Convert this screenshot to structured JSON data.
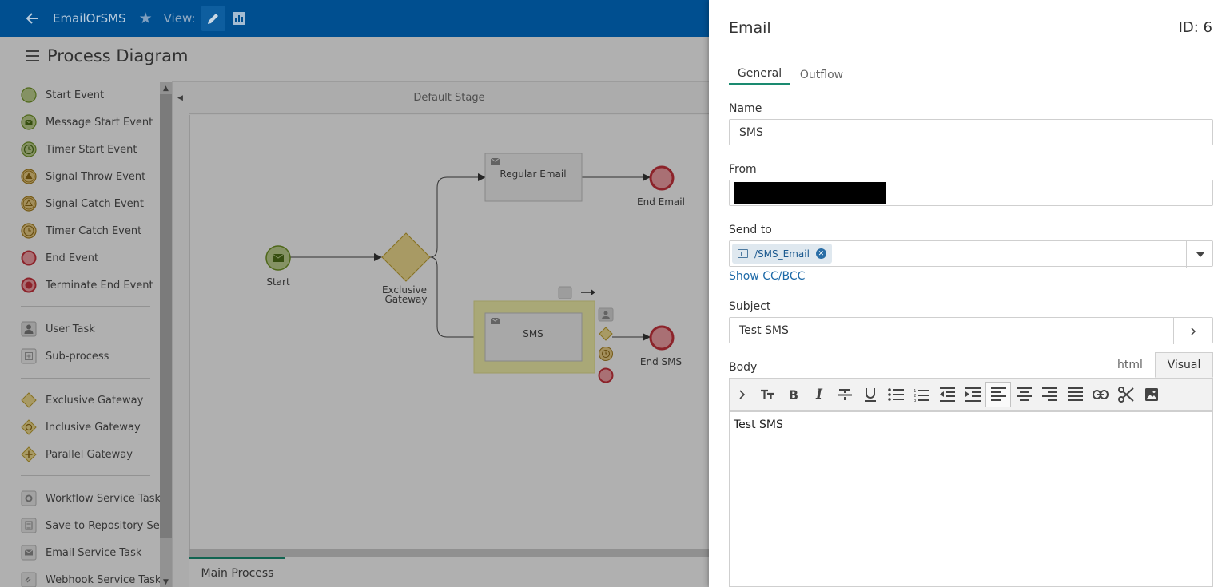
{
  "topbar": {
    "app_title": "EmailOrSMS",
    "view_label": "View:"
  },
  "page": {
    "title": "Process Diagram"
  },
  "palette": {
    "items": [
      {
        "label": "Start Event",
        "icon": "start-event-icon"
      },
      {
        "label": "Message Start Event",
        "icon": "message-start-event-icon"
      },
      {
        "label": "Timer Start Event",
        "icon": "timer-start-event-icon"
      },
      {
        "label": "Signal Throw Event",
        "icon": "signal-throw-event-icon"
      },
      {
        "label": "Signal Catch Event",
        "icon": "signal-catch-event-icon"
      },
      {
        "label": "Timer Catch Event",
        "icon": "timer-catch-event-icon"
      },
      {
        "label": "End Event",
        "icon": "end-event-icon"
      },
      {
        "label": "Terminate End Event",
        "icon": "terminate-end-event-icon"
      },
      {
        "label": "User Task",
        "icon": "user-task-icon"
      },
      {
        "label": "Sub-process",
        "icon": "sub-process-icon"
      },
      {
        "label": "Exclusive Gateway",
        "icon": "exclusive-gateway-icon"
      },
      {
        "label": "Inclusive Gateway",
        "icon": "inclusive-gateway-icon"
      },
      {
        "label": "Parallel Gateway",
        "icon": "parallel-gateway-icon"
      },
      {
        "label": "Workflow Service Task",
        "icon": "workflow-service-task-icon"
      },
      {
        "label": "Save to Repository Se...",
        "icon": "save-to-repository-icon"
      },
      {
        "label": "Email Service Task",
        "icon": "email-service-task-icon"
      },
      {
        "label": "Webhook Service Task",
        "icon": "webhook-service-task-icon"
      }
    ]
  },
  "diagram": {
    "stage_label": "Default Stage",
    "nodes": {
      "start": "Start",
      "gateway_line1": "Exclusive",
      "gateway_line2": "Gateway",
      "regular_email": "Regular Email",
      "sms": "SMS",
      "end_email": "End Email",
      "end_sms": "End SMS"
    },
    "bottom_tab": "Main Process"
  },
  "panel": {
    "title": "Email",
    "id_label": "ID: 6",
    "tabs": [
      "General",
      "Outflow"
    ],
    "name_label": "Name",
    "name_value": "SMS",
    "from_label": "From",
    "send_to_label": "Send to",
    "send_to_chip": "/SMS_Email",
    "show_cc_bcc": "Show CC/BCC",
    "subject_label": "Subject",
    "subject_value": "Test SMS",
    "body_label": "Body",
    "mode_tabs": [
      "html",
      "Visual"
    ],
    "body_text": "Test SMS"
  },
  "colors": {
    "topbar": "#004f90",
    "accent_tab": "#1a8a70",
    "link": "#1e6aa8",
    "end_event": "#c0303a",
    "start_event": "#6b8e23",
    "gateway": "#d4b84a"
  }
}
